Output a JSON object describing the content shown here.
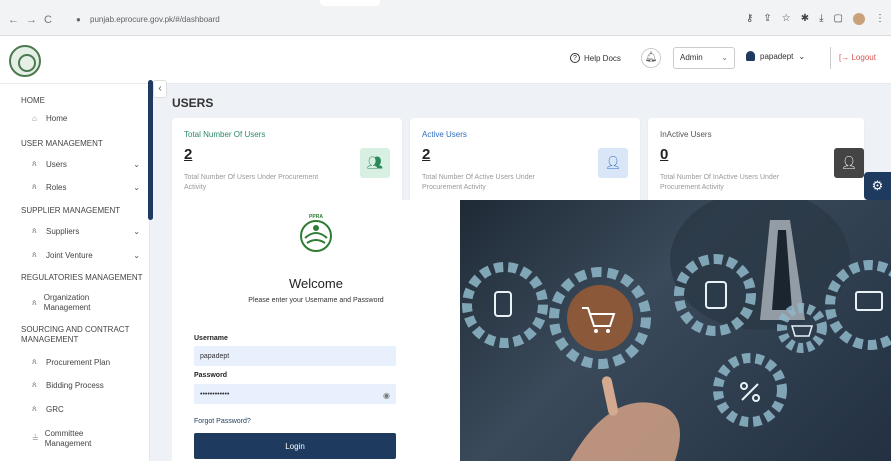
{
  "browser": {
    "url": "punjab.eprocure.gov.pk/#/dashboard",
    "nav": {
      "back": "←",
      "forward": "→",
      "reload": "C"
    },
    "icons": [
      "key-icon",
      "share-icon",
      "star-icon",
      "extension-icon",
      "download-icon",
      "split-icon",
      "profile-icon",
      "menu-icon"
    ]
  },
  "header": {
    "help_label": "Help Docs",
    "role_value": "Admin",
    "username": "papadept",
    "logout_label": "Logout",
    "colors": {
      "brand": "#1e3a5f",
      "logout": "#d9534f"
    }
  },
  "sidebar": {
    "sections": [
      {
        "label": "HOME",
        "items": [
          {
            "label": "Home",
            "icon": "home-icon",
            "expandable": false
          }
        ]
      },
      {
        "label": "USER MANAGEMENT",
        "items": [
          {
            "label": "Users",
            "icon": "users-icon",
            "expandable": true
          },
          {
            "label": "Roles",
            "icon": "users-icon",
            "expandable": true
          }
        ]
      },
      {
        "label": "SUPPLIER MANAGEMENT",
        "items": [
          {
            "label": "Suppliers",
            "icon": "users-icon",
            "expandable": true
          },
          {
            "label": "Joint Venture",
            "icon": "users-icon",
            "expandable": true
          }
        ]
      },
      {
        "label": "REGULATORIES MANAGEMENT",
        "items": [
          {
            "label": "Organization Management",
            "icon": "users-icon",
            "expandable": false
          }
        ]
      },
      {
        "label": "SOURCING AND CONTRACT MANAGEMENT",
        "items": [
          {
            "label": "Procurement Plan",
            "icon": "users-icon",
            "expandable": false
          },
          {
            "label": "Bidding Process",
            "icon": "users-icon",
            "expandable": false
          },
          {
            "label": "GRC",
            "icon": "users-icon",
            "expandable": false
          },
          {
            "label": "Committee Management",
            "icon": "committee-icon",
            "expandable": false
          }
        ]
      }
    ]
  },
  "main": {
    "title": "USERS",
    "cards": [
      {
        "title": "Total Number Of Users",
        "value": "2",
        "desc": "Total Number Of Users Under Procurement Activity",
        "title_color": "#2a8a6a",
        "icon": "users-group-icon",
        "icon_bg": "#d7f0e1",
        "icon_fg": "#2a8a5a"
      },
      {
        "title": "Active Users",
        "value": "2",
        "desc": "Total Number Of Active Users Under Procurement Activity",
        "title_color": "#2d6cc0",
        "icon": "user-check-icon",
        "icon_bg": "#d9e6f7",
        "icon_fg": "#2d6cc0"
      },
      {
        "title": "InActive Users",
        "value": "0",
        "desc": "Total Number Of InActive Users Under Procurement Activity",
        "title_color": "#555555",
        "icon": "user-x-icon",
        "icon_bg": "#444444",
        "icon_fg": "#ffffff"
      }
    ]
  },
  "login": {
    "logo_text": "PPRA",
    "welcome": "Welcome",
    "subtitle": "Please enter your Username and Password",
    "username_label": "Username",
    "username_value": "papadept",
    "password_label": "Password",
    "password_value": "••••••••••••",
    "forgot": "Forgot Password?",
    "login_button": "Login"
  }
}
